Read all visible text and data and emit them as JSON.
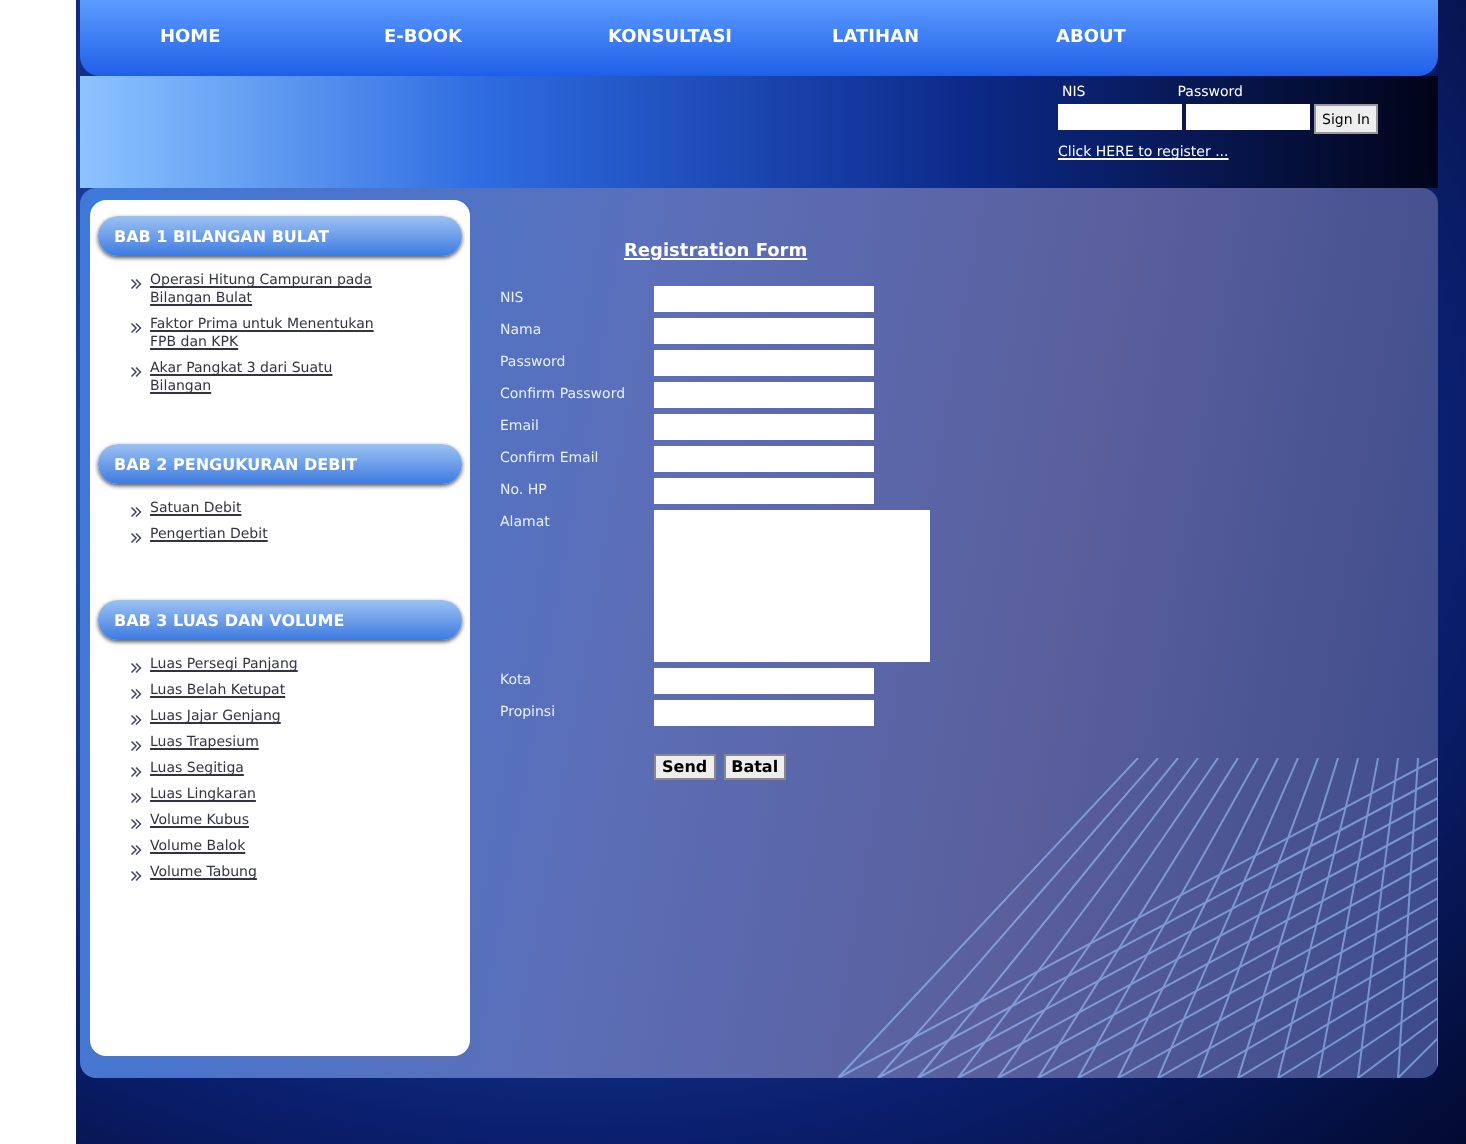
{
  "nav": [
    {
      "label": "HOME"
    },
    {
      "label": "E-BOOK"
    },
    {
      "label": "KONSULTASI"
    },
    {
      "label": "LATIHAN"
    },
    {
      "label": "ABOUT"
    }
  ],
  "login": {
    "nis_label": "NIS",
    "password_label": "Password",
    "button": "Sign In",
    "register_link": "Click HERE to register ..."
  },
  "sidebar": [
    {
      "title": "BAB 1 BILANGAN BULAT",
      "items": [
        "Operasi Hitung Campuran pada Bilangan Bulat",
        "Faktor Prima untuk Menentukan FPB dan KPK",
        "Akar Pangkat 3 dari Suatu Bilangan"
      ]
    },
    {
      "title": "BAB 2 PENGUKURAN DEBIT",
      "items": [
        "Satuan Debit",
        "Pengertian Debit"
      ]
    },
    {
      "title": "BAB 3 LUAS DAN VOLUME",
      "items": [
        "Luas Persegi Panjang",
        "Luas Belah Ketupat",
        "Luas Jajar Genjang",
        "Luas Trapesium",
        "Luas Segitiga",
        "Luas Lingkaran",
        "Volume Kubus",
        "Volume Balok",
        "Volume Tabung"
      ]
    }
  ],
  "form": {
    "title": "Registration Form",
    "fields": [
      {
        "label": "NIS",
        "kind": "text"
      },
      {
        "label": "Nama",
        "kind": "text"
      },
      {
        "label": "Password",
        "kind": "text"
      },
      {
        "label": "Confirm Password",
        "kind": "text"
      },
      {
        "label": "Email",
        "kind": "text"
      },
      {
        "label": "Confirm Email",
        "kind": "text"
      },
      {
        "label": "No. HP",
        "kind": "text"
      },
      {
        "label": "Alamat",
        "kind": "textarea"
      },
      {
        "label": "Kota",
        "kind": "text"
      },
      {
        "label": "Propinsi",
        "kind": "text"
      }
    ],
    "buttons": [
      "Send",
      "Batal"
    ]
  }
}
